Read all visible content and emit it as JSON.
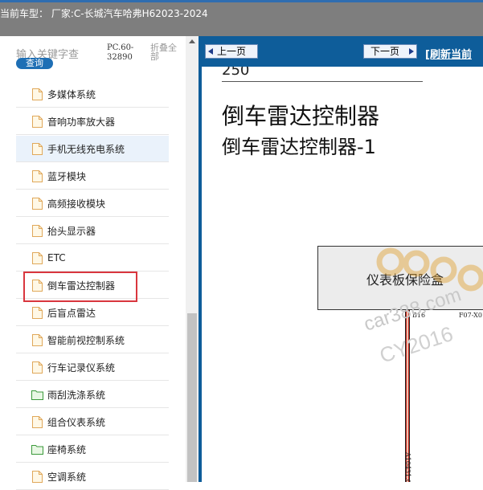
{
  "header": {
    "title": "当前车型：  厂家:C-长城汽车哈弗H62023-2024"
  },
  "sidebar": {
    "search_placeholder": "输入关键字查",
    "query_button": "查询",
    "pc_code": "PC.60-32890",
    "collapse_all": "折叠全部",
    "items": [
      {
        "label": "多媒体系统",
        "icon": "document-icon"
      },
      {
        "label": "音响功率放大器",
        "icon": "document-icon"
      },
      {
        "label": "手机无线充电系统",
        "icon": "document-icon"
      },
      {
        "label": "蓝牙模块",
        "icon": "document-icon"
      },
      {
        "label": "高频接收模块",
        "icon": "document-icon"
      },
      {
        "label": "抬头显示器",
        "icon": "document-icon"
      },
      {
        "label": "ETC",
        "icon": "document-icon"
      },
      {
        "label": "倒车雷达控制器",
        "icon": "document-icon"
      },
      {
        "label": "后盲点雷达",
        "icon": "document-icon"
      },
      {
        "label": "智能前视控制系统",
        "icon": "document-icon"
      },
      {
        "label": "行车记录仪系统",
        "icon": "document-icon"
      },
      {
        "label": "雨刮洗涤系统",
        "icon": "folder-icon"
      },
      {
        "label": "组合仪表系统",
        "icon": "document-icon"
      },
      {
        "label": "座椅系统",
        "icon": "folder-icon"
      },
      {
        "label": "空调系统",
        "icon": "document-icon"
      }
    ],
    "selected_item": "倒车雷达控制器"
  },
  "navigation": {
    "prev_label": "上一页",
    "next_label": "下一页",
    "refresh_label": "[刷新当前"
  },
  "document": {
    "page_number": "250",
    "title": "倒车雷达控制器",
    "subtitle": "倒车雷达控制器-1",
    "fuse_box_label": "仪表板保险盒",
    "pin_left": "B16",
    "pin_right": "F07-X01",
    "wire_label": "A10431.0"
  },
  "watermark": {
    "line1": "car388.com",
    "line2": "CY2016"
  },
  "colors": {
    "header_bg": "#7e7e7e",
    "nav_bg": "#0e5d9a",
    "query_button": "#1e6fb5",
    "highlight_box": "#d9363e",
    "wire": "#c8291f"
  }
}
